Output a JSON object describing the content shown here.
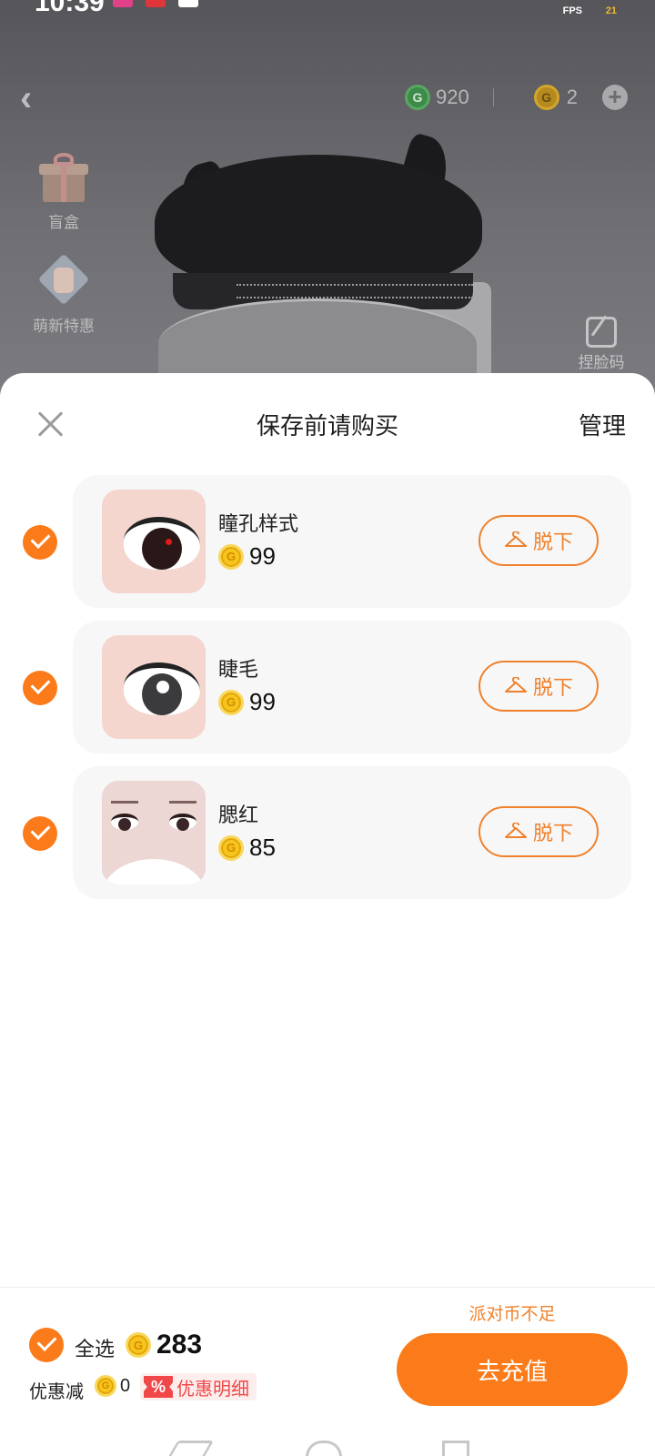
{
  "status_bar": {
    "time": "10:39",
    "fps_label": "FPS",
    "fps_value": "21"
  },
  "top_bar": {
    "green_coin_amount": "920",
    "gold_coin_amount": "2",
    "coin_glyph": "G"
  },
  "side_menu": {
    "items": [
      {
        "label": "盲盒",
        "icon": "gift-box-icon"
      },
      {
        "label": "萌新特惠",
        "icon": "bundle-icon"
      }
    ]
  },
  "scan_code": {
    "label": "捏脸码",
    "icon": "scan-code-icon"
  },
  "sheet": {
    "title": "保存前请购买",
    "manage_label": "管理",
    "remove_label": "脱下",
    "items": [
      {
        "name": "瞳孔样式",
        "price": "99",
        "checked": true
      },
      {
        "name": "睫毛",
        "price": "99",
        "checked": true
      },
      {
        "name": "腮红",
        "price": "85",
        "checked": true
      }
    ]
  },
  "footer": {
    "select_all_label": "全选",
    "total": "283",
    "discount_label": "优惠减",
    "discount_value": "0",
    "discount_badge_icon": "%",
    "discount_detail_label": "优惠明细",
    "insufficient_label": "派对币不足",
    "recharge_label": "去充值"
  },
  "colors": {
    "accent": "#fb7b1a",
    "outline_accent": "#f0812a",
    "coin_gold": "#f6c41c",
    "discount_red": "#f04848"
  }
}
